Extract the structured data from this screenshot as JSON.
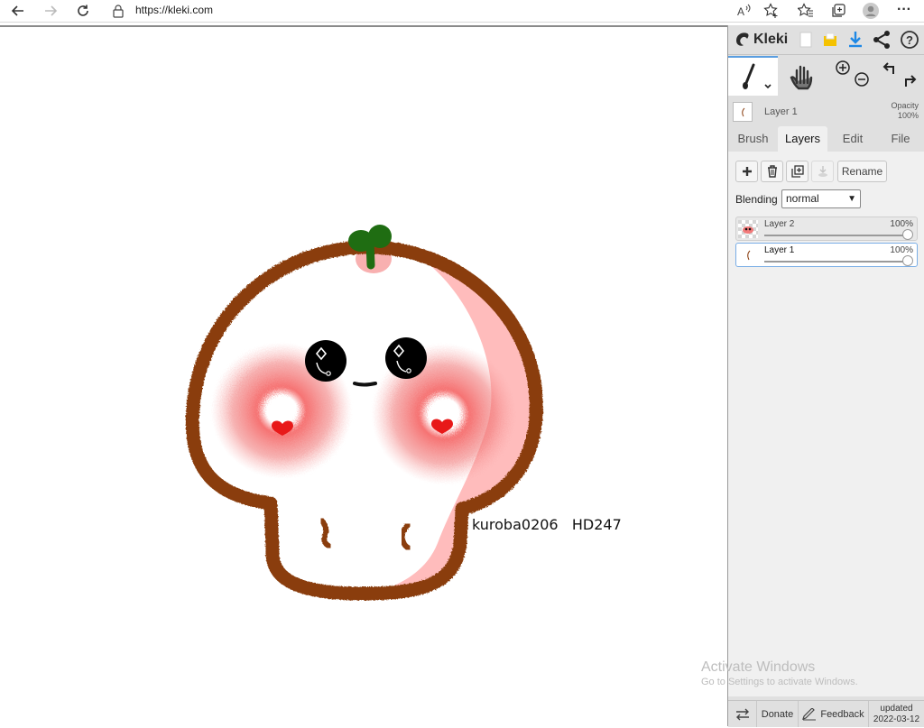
{
  "browser": {
    "url": "https://kleki.com",
    "icons": [
      "back-icon",
      "forward-icon",
      "refresh-icon",
      "lock-icon",
      "read-aloud-icon",
      "add-favorite-icon",
      "favorites-icon",
      "collections-icon",
      "profile-icon",
      "more-icon"
    ],
    "more_label": "···"
  },
  "canvas": {
    "signature_text": "kuroba0206   HD247"
  },
  "panel": {
    "logo_text": "Kleki",
    "top_icons": [
      "new-image-icon",
      "save-icon",
      "download-icon",
      "share-icon",
      "help-icon"
    ],
    "help_label": "?",
    "current_layer": {
      "name": "Layer 1",
      "opacity_label": "Opacity",
      "opacity_value": "100%"
    },
    "tabs": [
      {
        "label": "Brush",
        "active": false
      },
      {
        "label": "Layers",
        "active": true
      },
      {
        "label": "Edit",
        "active": false
      },
      {
        "label": "File",
        "active": false
      }
    ],
    "layer_buttons": {
      "rename_label": "Rename"
    },
    "blending": {
      "label": "Blending",
      "value": "normal"
    },
    "layers": [
      {
        "name": "Layer 2",
        "opacity": "100%",
        "selected": false
      },
      {
        "name": "Layer 1",
        "opacity": "100%",
        "selected": true
      }
    ],
    "bottom": {
      "donate_label": "Donate",
      "feedback_label": "Feedback",
      "updated_label": "updated",
      "updated_date": "2022-03-12"
    }
  },
  "watermark": {
    "title": "Activate Windows",
    "subtitle": "Go to Settings to activate Windows."
  },
  "colors": {
    "outline_brown": "#8a3e10",
    "stem_green": "#1f6d12",
    "blush_red": "#f26b6b",
    "shade_pink": "#ffbcbc",
    "heart_red": "#e81919",
    "accent_blue": "#1e88e5",
    "save_yellow": "#f5c200"
  }
}
